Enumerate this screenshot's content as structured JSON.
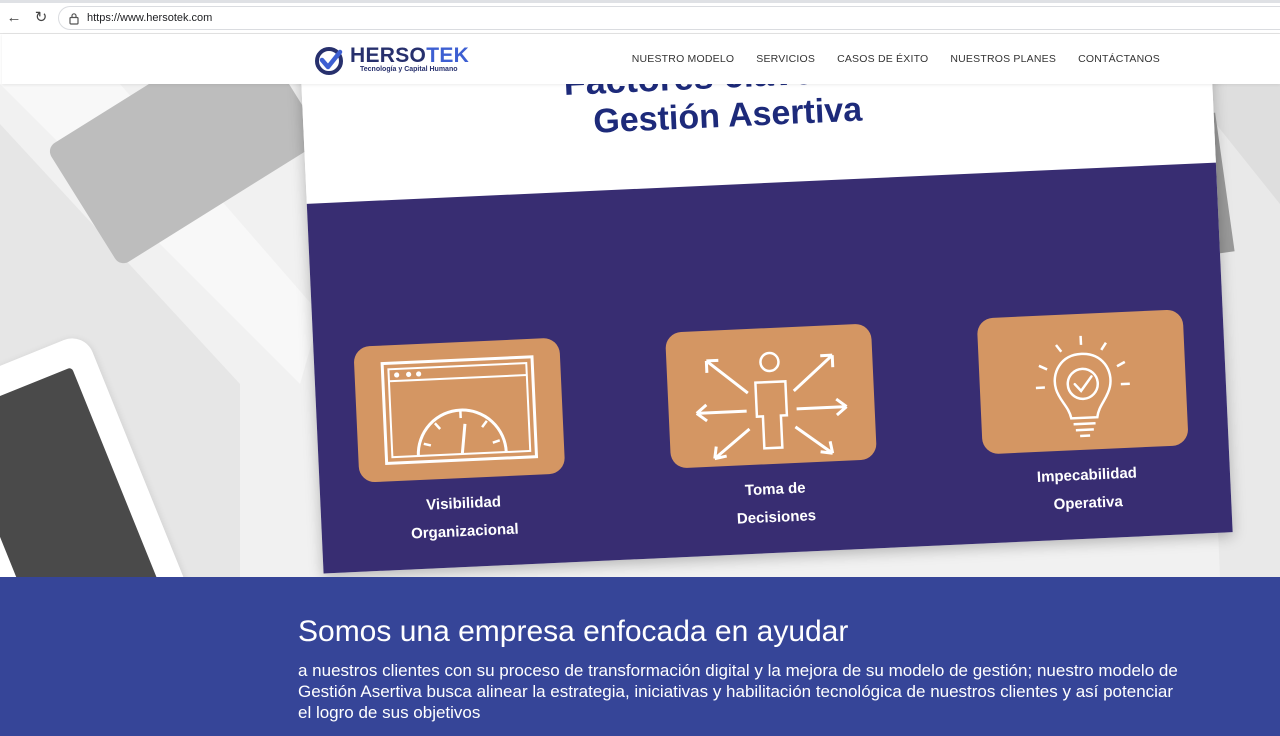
{
  "browser": {
    "url": "https://www.hersotek.com",
    "icons": [
      "back-arrow-icon",
      "reload-icon",
      "lock-icon"
    ]
  },
  "header": {
    "logo_name_main": "HERSO",
    "logo_name_accent": "TEK",
    "logo_tagline": "Tecnología y Capital Humano",
    "menu": [
      {
        "label": "NUESTRO MODELO"
      },
      {
        "label": "SERVICIOS"
      },
      {
        "label": "CASOS DE ÉXITO"
      },
      {
        "label": "NUESTROS PLANES"
      },
      {
        "label": "CONTÁCTANOS"
      }
    ]
  },
  "hero": {
    "title_line1": "Factores clave en la",
    "title_line2": "Gestión Asertiva",
    "tiles": [
      {
        "line1": "Visibilidad",
        "line2": "Organizacional",
        "icon": "dashboard-gauge-icon"
      },
      {
        "line1": "Toma de",
        "line2": "Decisiones",
        "icon": "person-arrows-icon"
      },
      {
        "line1": "Impecabilidad",
        "line2": "Operativa",
        "icon": "lightbulb-check-icon"
      }
    ]
  },
  "band": {
    "heading": "Somos una empresa enfocada en ayudar",
    "text": "a nuestros clientes con su proceso de transformación digital y la mejora de su modelo de gestión; nuestro modelo de Gestión Asertiva busca alinear la estrategia, iniciativas y habilitación tecnológica de nuestros clientes y así potenciar el logro de sus objetivos"
  },
  "colors": {
    "brand_navy": "#27306d",
    "brand_blue": "#3d5fd2",
    "card_purple": "#382d72",
    "tile_orange": "#d49663",
    "band_blue": "#364598"
  }
}
